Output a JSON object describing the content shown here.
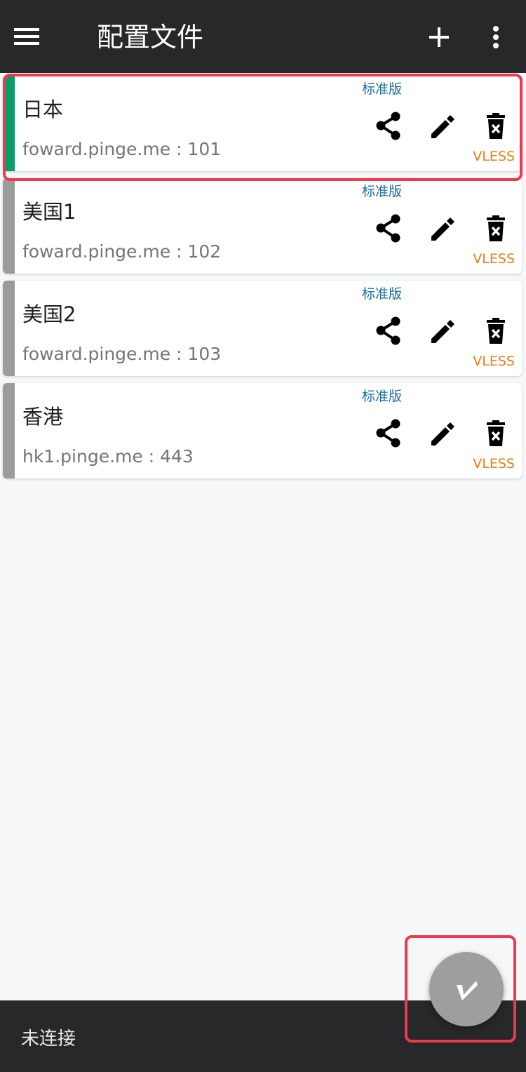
{
  "appbar": {
    "title": "配置文件",
    "menu_icon": "hamburger-menu-icon",
    "add_icon": "plus-icon",
    "more_icon": "more-vertical-icon"
  },
  "profiles": [
    {
      "name": "日本",
      "address": "foward.pinge.me : 101",
      "tier": "标准版",
      "protocol": "VLESS",
      "selected": true
    },
    {
      "name": "美国1",
      "address": "foward.pinge.me : 102",
      "tier": "标准版",
      "protocol": "VLESS",
      "selected": false
    },
    {
      "name": "美国2",
      "address": "foward.pinge.me : 103",
      "tier": "标准版",
      "protocol": "VLESS",
      "selected": false
    },
    {
      "name": "香港",
      "address": "hk1.pinge.me : 443",
      "tier": "标准版",
      "protocol": "VLESS",
      "selected": false
    }
  ],
  "card_icons": {
    "share": "share-icon",
    "edit": "pencil-icon",
    "delete": "delete-icon"
  },
  "status": {
    "text": "未连接"
  },
  "fab": {
    "icon": "vpn-connect-icon"
  },
  "colors": {
    "appbar_background": "#272829",
    "selected_indicator": "#0b9a6a",
    "unselected_indicator": "#9b9b9b",
    "tier_text": "#1f6f9b",
    "protocol_text": "#ef7b12",
    "highlight_border": "#f0384d",
    "fab_background": "#9e9e9e"
  }
}
